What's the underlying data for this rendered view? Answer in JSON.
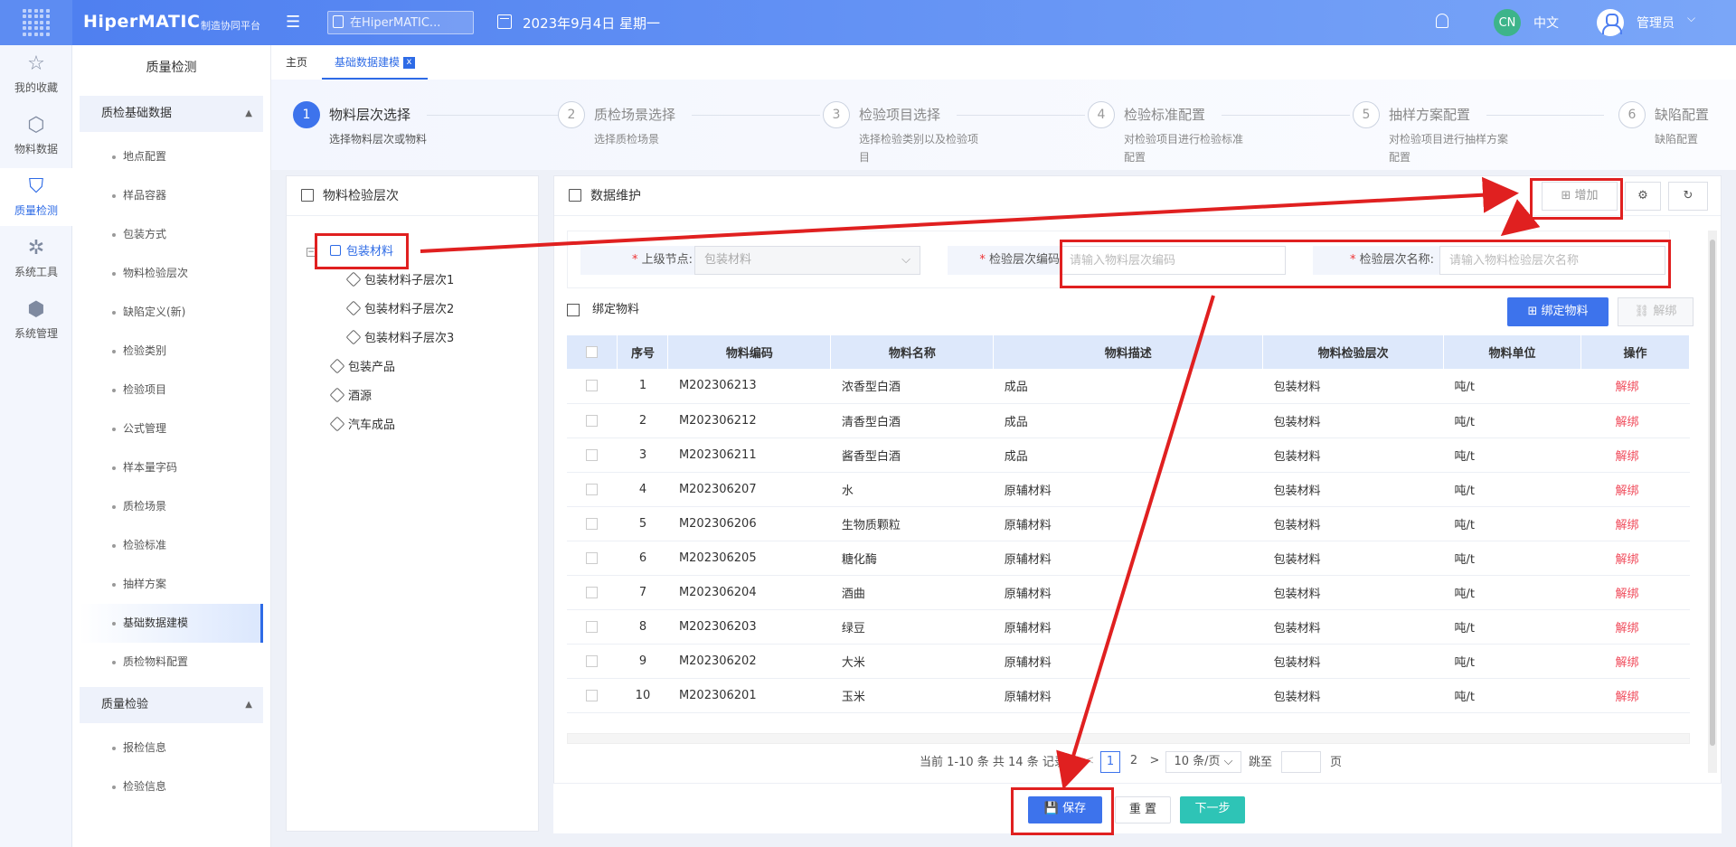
{
  "header": {
    "brand": "HiperMATIC",
    "brand_sub": "制造协同平台",
    "search_placeholder": "在HiperMATIC...",
    "date": "2023年9月4日 星期一",
    "lang_badge": "CN",
    "lang": "中文",
    "user": "管理员"
  },
  "rail": [
    {
      "label": "我的收藏",
      "icon": "star-icon"
    },
    {
      "label": "物料数据",
      "icon": "cube-icon"
    },
    {
      "label": "质量检测",
      "icon": "shield-icon"
    },
    {
      "label": "系统工具",
      "icon": "network-icon"
    },
    {
      "label": "系统管理",
      "icon": "gear-cube-icon"
    }
  ],
  "sidebar": {
    "title": "质量检测",
    "group1": "质检基础数据",
    "items1": [
      "地点配置",
      "样品容器",
      "包装方式",
      "物料检验层次",
      "缺陷定义(新)",
      "检验类别",
      "检验项目",
      "公式管理",
      "样本量字码",
      "质检场景",
      "检验标准",
      "抽样方案",
      "基础数据建模",
      "质检物料配置"
    ],
    "group2": "质量检验",
    "items2": [
      "报检信息",
      "检验信息"
    ]
  },
  "tabs": {
    "home": "主页",
    "active": "基础数据建模",
    "close": "x"
  },
  "steps": [
    {
      "num": "1",
      "title": "物料层次选择",
      "desc": "选择物料层次或物料"
    },
    {
      "num": "2",
      "title": "质检场景选择",
      "desc": "选择质检场景"
    },
    {
      "num": "3",
      "title": "检验项目选择",
      "desc": "选择检验类别以及检验项目"
    },
    {
      "num": "4",
      "title": "检验标准配置",
      "desc": "对检验项目进行检验标准配置"
    },
    {
      "num": "5",
      "title": "抽样方案配置",
      "desc": "对检验项目进行抽样方案配置"
    },
    {
      "num": "6",
      "title": "缺陷配置",
      "desc": "缺陷配置"
    }
  ],
  "tree": {
    "title": "物料检验层次",
    "root": "包装材料",
    "children": [
      "包装材料子层次1",
      "包装材料子层次2",
      "包装材料子层次3"
    ],
    "others": [
      "包装产品",
      "酒源",
      "汽车成品"
    ]
  },
  "data_panel": {
    "title": "数据维护",
    "add": "增加"
  },
  "form": {
    "parent_label": "上级节点:",
    "parent_value": "包装材料",
    "code_label": "检验层次编码",
    "code_placeholder": "请输入物料层次编码",
    "name_label": "检验层次名称:",
    "name_placeholder": "请输入物料检验层次名称",
    "required": "*"
  },
  "bind": {
    "title": "绑定物料",
    "bind_btn": "绑定物料",
    "unbind_btn": "解绑"
  },
  "table": {
    "headers": [
      "序号",
      "物料编码",
      "物料名称",
      "物料描述",
      "物料检验层次",
      "物料单位",
      "操作"
    ],
    "rows": [
      [
        "1",
        "M202306213",
        "浓香型白酒",
        "成品",
        "包装材料",
        "吨/t",
        "解绑"
      ],
      [
        "2",
        "M202306212",
        "清香型白酒",
        "成品",
        "包装材料",
        "吨/t",
        "解绑"
      ],
      [
        "3",
        "M202306211",
        "酱香型白酒",
        "成品",
        "包装材料",
        "吨/t",
        "解绑"
      ],
      [
        "4",
        "M202306207",
        "水",
        "原辅材料",
        "包装材料",
        "吨/t",
        "解绑"
      ],
      [
        "5",
        "M202306206",
        "生物质颗粒",
        "原辅材料",
        "包装材料",
        "吨/t",
        "解绑"
      ],
      [
        "6",
        "M202306205",
        "糖化酶",
        "原辅材料",
        "包装材料",
        "吨/t",
        "解绑"
      ],
      [
        "7",
        "M202306204",
        "酒曲",
        "原辅材料",
        "包装材料",
        "吨/t",
        "解绑"
      ],
      [
        "8",
        "M202306203",
        "绿豆",
        "原辅材料",
        "包装材料",
        "吨/t",
        "解绑"
      ],
      [
        "9",
        "M202306202",
        "大米",
        "原辅材料",
        "包装材料",
        "吨/t",
        "解绑"
      ],
      [
        "10",
        "M202306201",
        "玉米",
        "原辅材料",
        "包装材料",
        "吨/t",
        "解绑"
      ]
    ]
  },
  "pager": {
    "summary": "当前 1-10 条 共 14 条 记录",
    "p1": "1",
    "p2": "2",
    "size": "10 条/页",
    "jump": "跳至",
    "page": "页",
    "prev": "<",
    "next": ">"
  },
  "footer": {
    "save": "保存",
    "reset": "重 置",
    "next": "下一步"
  }
}
